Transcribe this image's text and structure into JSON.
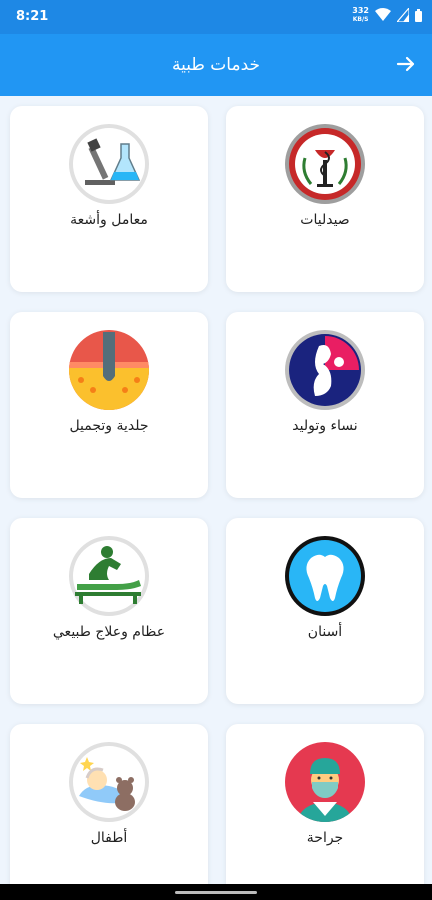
{
  "status_bar": {
    "time": "8:21",
    "speed_value": "332",
    "speed_unit": "KB/S"
  },
  "app_bar": {
    "title": "خدمات طبية"
  },
  "categories": [
    {
      "label": "صيدليات",
      "icon": "pharmacy-icon"
    },
    {
      "label": "معامل وأشعة",
      "icon": "lab-icon"
    },
    {
      "label": "نساء وتوليد",
      "icon": "pregnancy-icon"
    },
    {
      "label": "جلدية وتجميل",
      "icon": "skin-icon"
    },
    {
      "label": "أسنان",
      "icon": "tooth-icon"
    },
    {
      "label": "عظام وعلاج طبيعي",
      "icon": "physiotherapy-icon"
    },
    {
      "label": "جراحة",
      "icon": "surgeon-icon"
    },
    {
      "label": "أطفال",
      "icon": "baby-icon"
    }
  ],
  "colors": {
    "primary": "#2196f3",
    "status_bar": "#1e88e5",
    "background": "#eef5fd"
  }
}
